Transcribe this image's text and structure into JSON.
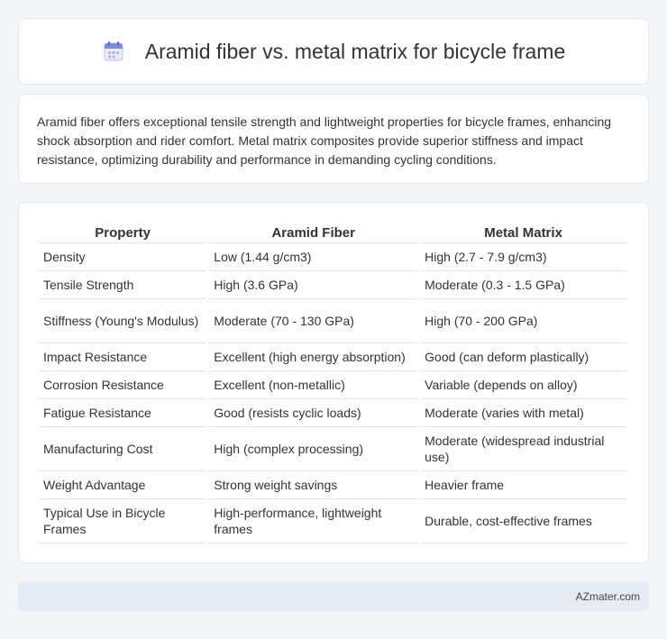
{
  "header": {
    "title": "Aramid fiber vs. metal matrix for bicycle frame",
    "icon": "calendar-icon"
  },
  "summary": {
    "text": "Aramid fiber offers exceptional tensile strength and lightweight properties for bicycle frames, enhancing shock absorption and rider comfort. Metal matrix composites provide superior stiffness and impact resistance, optimizing durability and performance in demanding cycling conditions."
  },
  "table": {
    "headers": [
      "Property",
      "Aramid Fiber",
      "Metal Matrix"
    ],
    "rows": [
      [
        "Density",
        "Low (1.44 g/cm3)",
        "High (2.7 - 7.9 g/cm3)"
      ],
      [
        "Tensile Strength",
        "High (3.6 GPa)",
        "Moderate (0.3 - 1.5 GPa)"
      ],
      [
        "Stiffness (Young's Modulus)",
        "Moderate (70 - 130 GPa)",
        "High (70 - 200 GPa)"
      ],
      [
        "Impact Resistance",
        "Excellent (high energy absorption)",
        "Good (can deform plastically)"
      ],
      [
        "Corrosion Resistance",
        "Excellent (non-metallic)",
        "Variable (depends on alloy)"
      ],
      [
        "Fatigue Resistance",
        "Good (resists cyclic loads)",
        "Moderate (varies with metal)"
      ],
      [
        "Manufacturing Cost",
        "High (complex processing)",
        "Moderate (widespread industrial use)"
      ],
      [
        "Weight Advantage",
        "Strong weight savings",
        "Heavier frame"
      ],
      [
        "Typical Use in Bicycle Frames",
        "High-performance, lightweight frames",
        "Durable, cost-effective frames"
      ]
    ]
  },
  "footer": {
    "text": "AZmater.com"
  },
  "colors": {
    "background": "#f3f5f9",
    "card": "#ffffff",
    "footer": "#e6ecf6",
    "icon_accent": "#6f7de0"
  }
}
